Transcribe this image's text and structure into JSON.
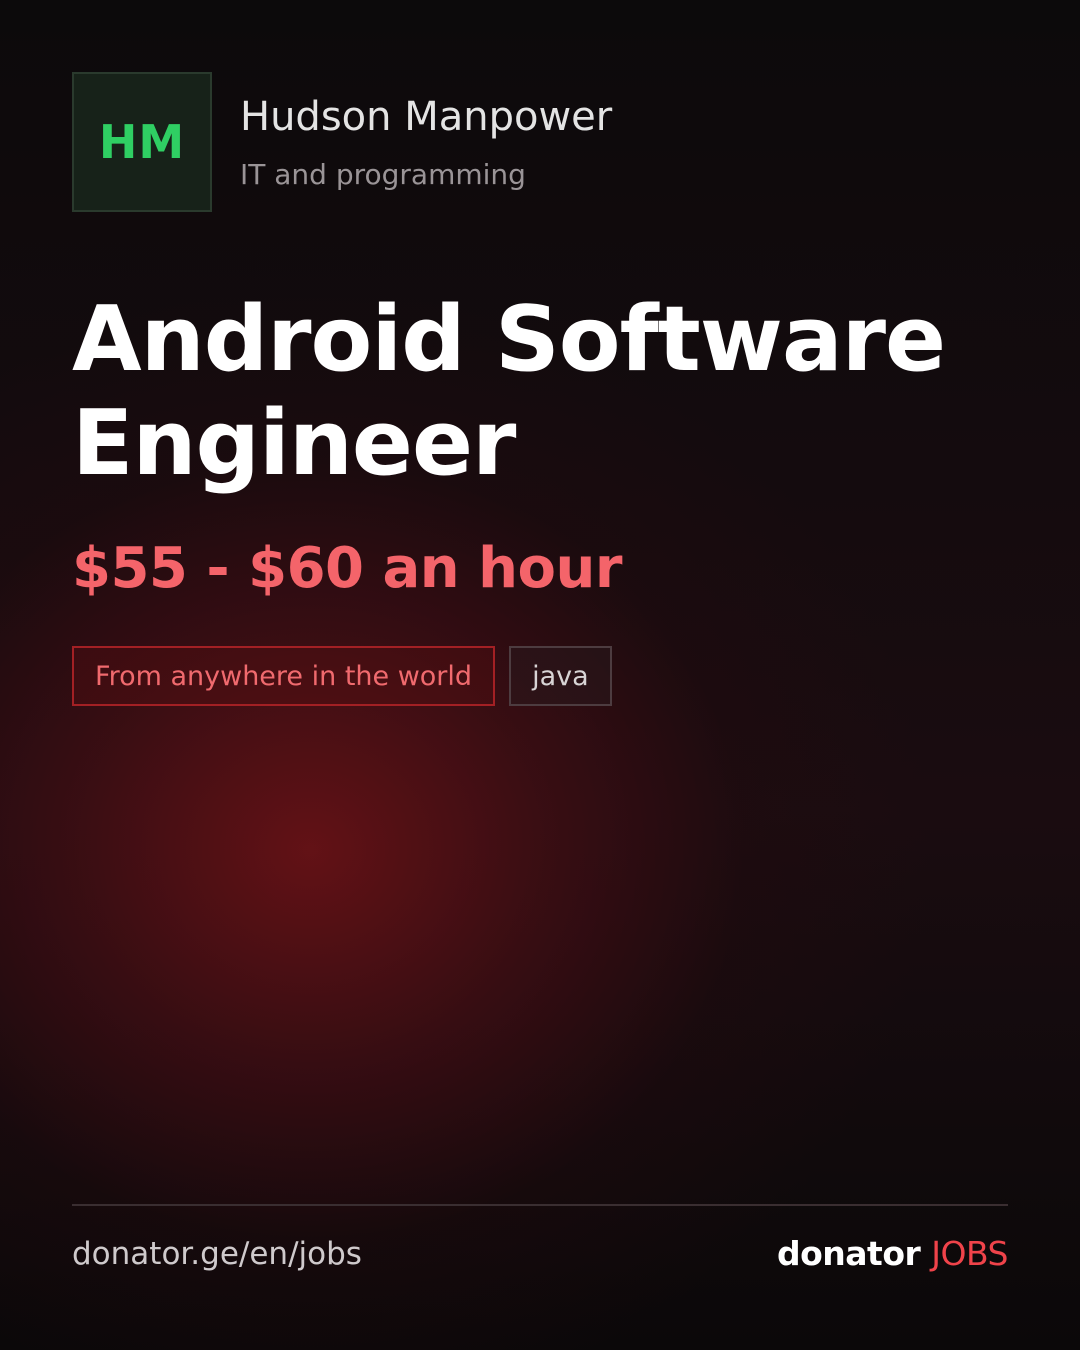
{
  "company": {
    "logo_initials": "HM",
    "name": "Hudson Manpower",
    "category": "IT and programming"
  },
  "job": {
    "title": "Android Software Engineer",
    "salary": "$55 - $60 an hour",
    "tags": [
      {
        "label": "From anywhere in the world",
        "kind": "location"
      },
      {
        "label": "java",
        "kind": "skill"
      }
    ]
  },
  "footer": {
    "url": "donator.ge/en/jobs",
    "brand_main": "donator",
    "brand_accent": "JOBS"
  },
  "colors": {
    "logo_accent": "#2fcf63",
    "salary": "#f4646a",
    "brand_accent": "#f0434a",
    "location_tag_border": "#a32024"
  }
}
